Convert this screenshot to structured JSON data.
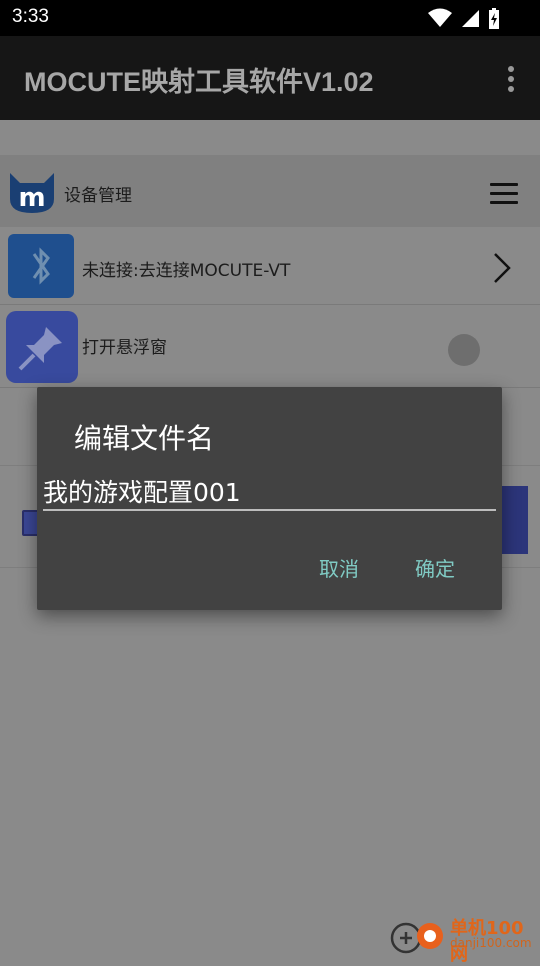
{
  "status_bar": {
    "time": "3:33"
  },
  "app_bar": {
    "title": "MOCUTE映射工具软件V1.02"
  },
  "device_section": {
    "label": "设备管理"
  },
  "rows": [
    {
      "label": "未连接:去连接MOCUTE-VT"
    },
    {
      "label": "打开悬浮窗",
      "toggle_on": false
    }
  ],
  "dialog": {
    "title": "编辑文件名",
    "input_value": "我的游戏配置001",
    "cancel_label": "取消",
    "ok_label": "确定"
  },
  "watermark": {
    "text_cn": "单机100网",
    "text_en": "danji100.com"
  },
  "colors": {
    "accent": "#80cbc4",
    "dialog_bg": "#424242",
    "statusbar_bg": "#000000",
    "appbar_bg": "#161616"
  }
}
